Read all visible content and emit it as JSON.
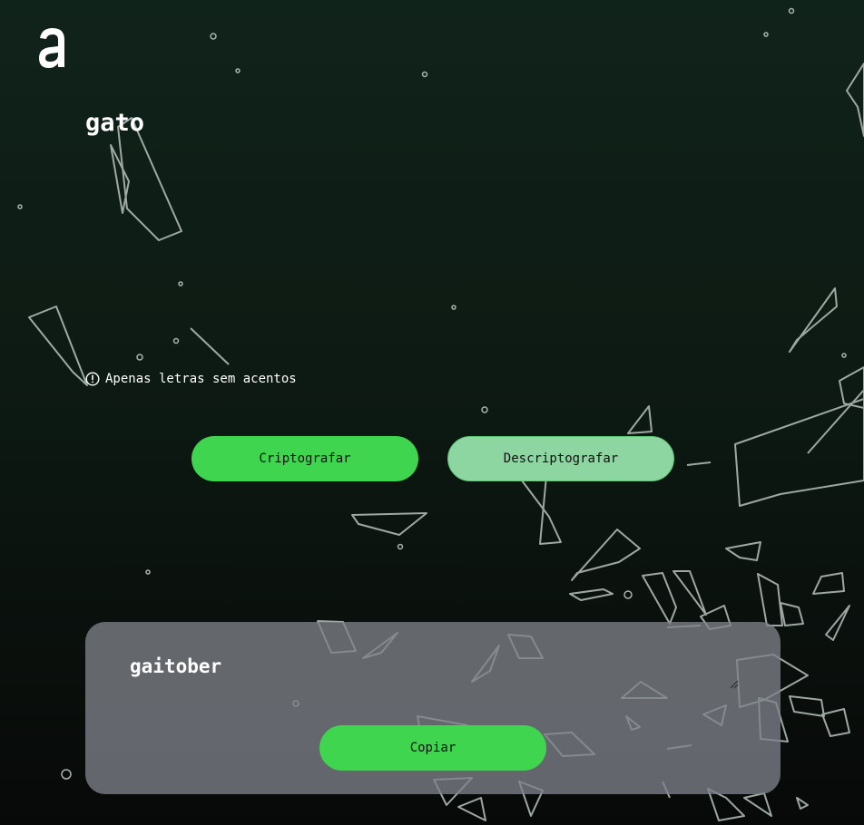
{
  "app": {
    "logo_icon": "a-logo-icon"
  },
  "input": {
    "value": "gato"
  },
  "hint": {
    "icon": "exclamation-circle-icon",
    "text": "Apenas letras sem acentos"
  },
  "actions": {
    "encrypt_label": "Criptografar",
    "decrypt_label": "Descriptografar"
  },
  "output": {
    "value": "gaitober",
    "copy_label": "Copiar"
  },
  "colors": {
    "primary_button": "#40d54e",
    "secondary_button": "#8ed6a1",
    "panel": "#7e8289",
    "background_top": "#10231a",
    "background_bottom": "#070908"
  }
}
